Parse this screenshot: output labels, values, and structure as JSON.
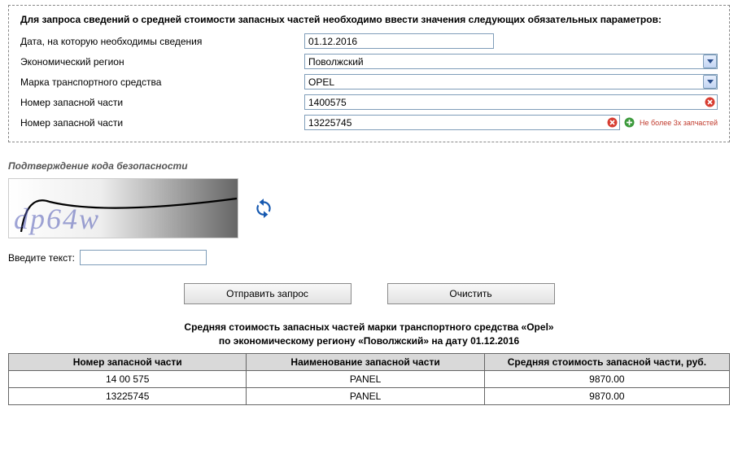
{
  "heading": "Для запроса сведений о средней стоимости запасных частей необходимо ввести значения следующих обязательных параметров:",
  "form": {
    "date_label": "Дата, на которую необходимы сведения",
    "date_value": "01.12.2016",
    "region_label": "Экономический регион",
    "region_value": "Поволжский",
    "brand_label": "Марка транспортного средства",
    "brand_value": "OPEL",
    "part1_label": "Номер запасной части",
    "part1_value": "1400575",
    "part2_label": "Номер запасной части",
    "part2_value": "13225745",
    "limit_note": "Не более 3х запчастей"
  },
  "captcha": {
    "title": "Подтверждение кода безопасности",
    "value": "dp64w",
    "enter_label": "Введите текст:"
  },
  "buttons": {
    "submit": "Отправить запрос",
    "clear": "Очистить"
  },
  "result": {
    "title_line1": "Средняя стоимость запасных частей марки транспортного средства «Opel»",
    "title_line2": "по экономическому региону «Поволжский» на дату 01.12.2016",
    "col1": "Номер запасной части",
    "col2": "Наименование запасной части",
    "col3": "Средняя стоимость запасной части, руб.",
    "rows": [
      {
        "num": "14 00 575",
        "name": "PANEL",
        "price": "9870.00"
      },
      {
        "num": "13225745",
        "name": "PANEL",
        "price": "9870.00"
      }
    ]
  }
}
